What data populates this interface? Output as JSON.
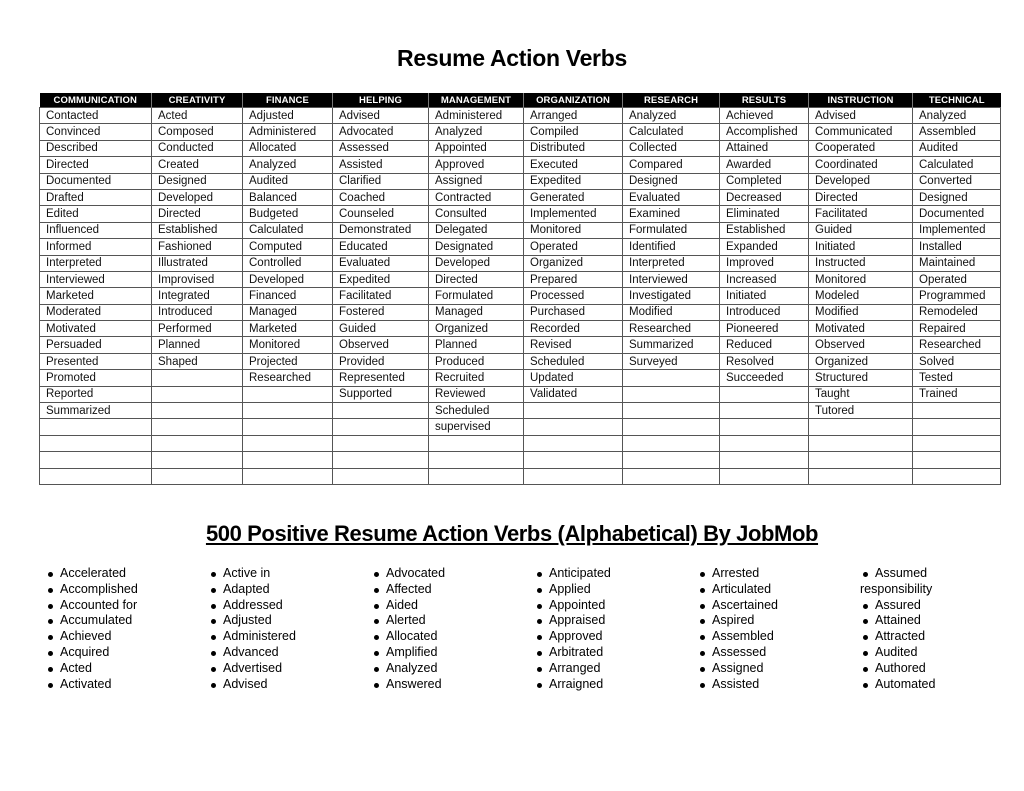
{
  "title": "Resume Action Verbs",
  "table": {
    "row_count": 23,
    "columns": [
      {
        "header": "COMMUNICATION",
        "items": [
          "Contacted",
          "Convinced",
          "Described",
          "Directed",
          "Documented",
          "Drafted",
          "Edited",
          "Influenced",
          "Informed",
          "Interpreted",
          "Interviewed",
          "Marketed",
          "Moderated",
          "Motivated",
          "Persuaded",
          "Presented",
          "Promoted",
          "Reported",
          "Summarized"
        ]
      },
      {
        "header": "CREATIVITY",
        "items": [
          "Acted",
          "Composed",
          "Conducted",
          "Created",
          "Designed",
          "Developed",
          "Directed",
          "Established",
          "Fashioned",
          "Illustrated",
          "Improvised",
          "Integrated",
          "Introduced",
          "Performed",
          "Planned",
          "Shaped"
        ]
      },
      {
        "header": "FINANCE",
        "items": [
          "Adjusted",
          "Administered",
          "Allocated",
          "Analyzed",
          "Audited",
          "Balanced",
          "Budgeted",
          "Calculated",
          "Computed",
          "Controlled",
          "Developed",
          "Financed",
          "Managed",
          "Marketed",
          "Monitored",
          "Projected",
          "Researched"
        ]
      },
      {
        "header": "HELPING",
        "items": [
          "Advised",
          "Advocated",
          "Assessed",
          "Assisted",
          "Clarified",
          "Coached",
          "Counseled",
          "Demonstrated",
          "Educated",
          "Evaluated",
          "Expedited",
          "Facilitated",
          "Fostered",
          "Guided",
          "Observed",
          "Provided",
          "Represented",
          "Supported"
        ]
      },
      {
        "header": "MANAGEMENT",
        "items": [
          "Administered",
          "Analyzed",
          "Appointed",
          "Approved",
          "Assigned",
          "Contracted",
          "Consulted",
          "Delegated",
          "Designated",
          "Developed",
          "Directed",
          "Formulated",
          "Managed",
          "Organized",
          "Planned",
          "Produced",
          "Recruited",
          "Reviewed",
          "Scheduled",
          "supervised"
        ]
      },
      {
        "header": "ORGANIZATION",
        "items": [
          "Arranged",
          "Compiled",
          "Distributed",
          "Executed",
          "Expedited",
          "Generated",
          "Implemented",
          "Monitored",
          "Operated",
          "Organized",
          "Prepared",
          "Processed",
          "Purchased",
          "Recorded",
          "Revised",
          "Scheduled",
          "Updated",
          "Validated"
        ]
      },
      {
        "header": "RESEARCH",
        "items": [
          "Analyzed",
          "Calculated",
          "Collected",
          "Compared",
          "Designed",
          "Evaluated",
          "Examined",
          "Formulated",
          "Identified",
          "Interpreted",
          "Interviewed",
          "Investigated",
          "Modified",
          "Researched",
          "Summarized",
          "Surveyed"
        ]
      },
      {
        "header": "RESULTS",
        "items": [
          "Achieved",
          "Accomplished",
          "Attained",
          "Awarded",
          "Completed",
          "Decreased",
          "Eliminated",
          "Established",
          "Expanded",
          "Improved",
          "Increased",
          "Initiated",
          "Introduced",
          "Pioneered",
          "Reduced",
          "Resolved",
          "Succeeded"
        ]
      },
      {
        "header": "INSTRUCTION",
        "items": [
          "Advised",
          "Communicated",
          "Cooperated",
          "Coordinated",
          "Developed",
          "Directed",
          "Facilitated",
          "Guided",
          "Initiated",
          "Instructed",
          "Monitored",
          "Modeled",
          "Modified",
          "Motivated",
          "Observed",
          "Organized",
          "Structured",
          "Taught",
          "Tutored"
        ]
      },
      {
        "header": "TECHNICAL",
        "items": [
          "Analyzed",
          "Assembled",
          "Audited",
          "Calculated",
          "Converted",
          "Designed",
          "Documented",
          "Implemented",
          "Installed",
          "Maintained",
          "Operated",
          "Programmed",
          "Remodeled",
          "Repaired",
          "Researched",
          "Solved",
          "Tested",
          "Trained"
        ]
      }
    ]
  },
  "subtitle": "500 Positive Resume Action Verbs (Alphabetical) By JobMob",
  "alphabetical_lists": [
    [
      "Accelerated",
      "Accomplished",
      "Accounted for",
      "Accumulated",
      "Achieved",
      "Acquired",
      "Acted",
      "Activated"
    ],
    [
      "Active in",
      "Adapted",
      "Addressed",
      "Adjusted",
      "Administered",
      "Advanced",
      "Advertised",
      "Advised"
    ],
    [
      "Advocated",
      "Affected",
      "Aided",
      "Alerted",
      "Allocated",
      "Amplified",
      "Analyzed",
      "Answered"
    ],
    [
      "Anticipated",
      "Applied",
      "Appointed",
      "Appraised",
      "Approved",
      "Arbitrated",
      "Arranged",
      "Arraigned"
    ],
    [
      "Arrested",
      "Articulated",
      "Ascertained",
      "Aspired",
      "Assembled",
      "Assessed",
      "Assigned",
      "Assisted"
    ],
    [
      "Assumed responsibility",
      "Assured",
      "Attained",
      "Attracted",
      "Audited",
      "Authored",
      "Automated"
    ]
  ]
}
